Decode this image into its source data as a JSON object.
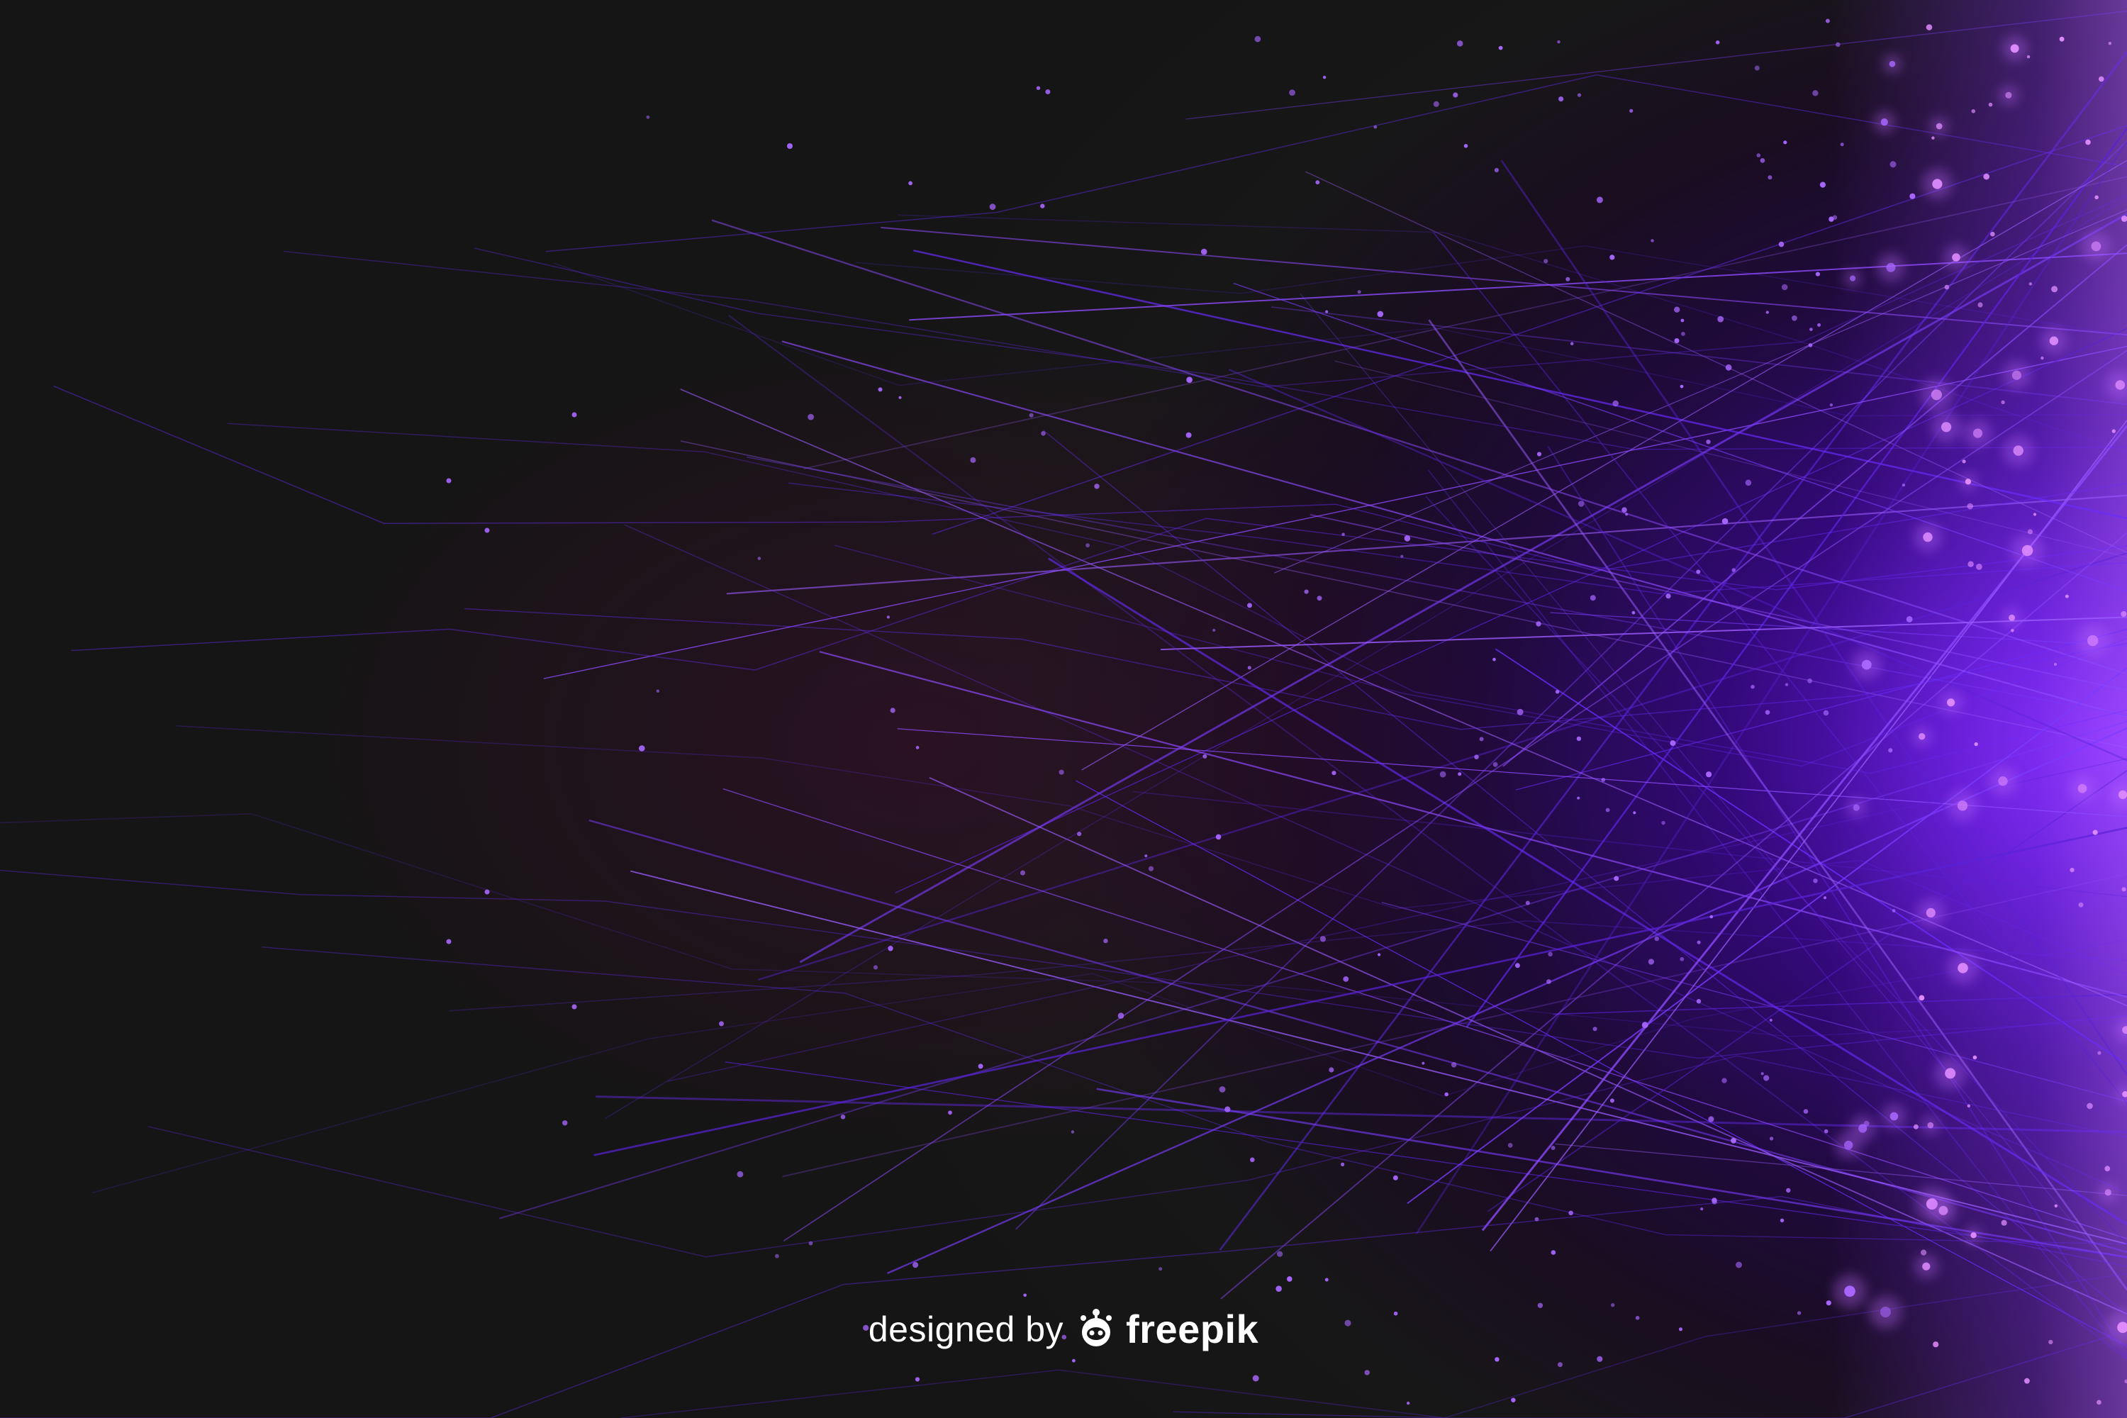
{
  "credit": {
    "prefix": "designed by",
    "brand": "freepik",
    "logo_icon": "freepik-logo-icon"
  },
  "palette": {
    "background": "#161616",
    "line": "#7b3cff",
    "particle": "#b46bff",
    "glow": "#8a2cff"
  }
}
